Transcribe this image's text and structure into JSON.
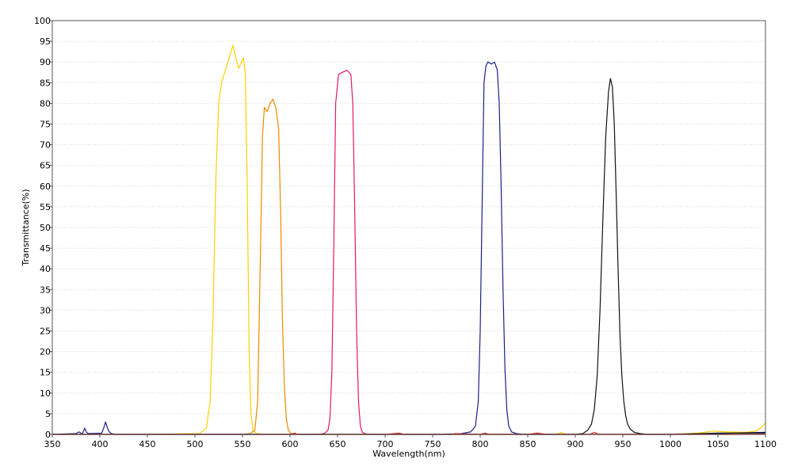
{
  "chart_data": {
    "type": "line",
    "title": "",
    "xlabel": "Wavelength(nm)",
    "ylabel": "Transmittance(%)",
    "xlim": [
      350,
      1100
    ],
    "ylim": [
      0,
      100
    ],
    "xticks": [
      350,
      400,
      450,
      500,
      550,
      600,
      650,
      700,
      750,
      800,
      850,
      900,
      950,
      1000,
      1050,
      1100
    ],
    "yticks": [
      0,
      5,
      10,
      15,
      20,
      25,
      30,
      35,
      40,
      45,
      50,
      55,
      60,
      65,
      70,
      75,
      80,
      85,
      90,
      95,
      100
    ],
    "grid": true,
    "legend": "none",
    "series": [
      {
        "color": "#ffd000",
        "x": [
          350,
          450,
          505,
          512,
          516,
          519,
          522,
          525,
          528,
          532,
          536,
          540,
          543,
          546,
          549,
          551,
          553,
          555,
          557,
          559,
          561,
          564,
          570,
          600,
          700,
          880,
          885,
          890,
          1000,
          1030,
          1045,
          1060,
          1080,
          1090,
          1095,
          1100
        ],
        "y": [
          0,
          0,
          0.2,
          1.5,
          8,
          28,
          62,
          80,
          85,
          88,
          91,
          94,
          91,
          88.5,
          90,
          91,
          87,
          60,
          20,
          5,
          1,
          0.3,
          0,
          0,
          0,
          0,
          0.5,
          0,
          0,
          0.3,
          0.8,
          0.6,
          0.5,
          0.8,
          1.5,
          2.8
        ]
      },
      {
        "color": "#ee8800",
        "x": [
          350,
          550,
          558,
          563,
          566,
          569,
          571,
          573,
          576,
          579,
          582,
          585,
          588,
          590,
          592,
          594,
          596,
          598,
          600,
          603,
          610,
          700,
          1100
        ],
        "y": [
          0,
          0,
          0.2,
          1,
          8,
          45,
          72,
          79,
          78,
          80,
          81,
          79,
          74,
          55,
          28,
          12,
          4,
          1.2,
          0.4,
          0.1,
          0,
          0,
          0
        ]
      },
      {
        "color": "#e0186c",
        "x": [
          350,
          630,
          636,
          640,
          642,
          644,
          646,
          648,
          651,
          655,
          660,
          664,
          666,
          668,
          670,
          672,
          674,
          676,
          680,
          685,
          700,
          1100
        ],
        "y": [
          0,
          0,
          0.2,
          1,
          4,
          15,
          45,
          80,
          87,
          87.5,
          88,
          87,
          80,
          55,
          25,
          8,
          2,
          0.5,
          0.1,
          0,
          0,
          0
        ]
      },
      {
        "color": "#1c2088",
        "x": [
          350,
          375,
          378,
          381,
          382,
          384,
          386,
          388,
          402,
          404,
          406,
          408,
          410,
          412,
          416,
          420,
          500,
          760,
          780,
          790,
          795,
          798,
          800,
          802,
          804,
          806,
          808,
          812,
          815,
          818,
          820,
          822,
          824,
          826,
          828,
          830,
          833,
          838,
          845,
          860,
          1000,
          1050,
          1100
        ],
        "y": [
          0,
          0.2,
          0.6,
          0.2,
          0.3,
          1.5,
          0.5,
          0.2,
          0.3,
          1.5,
          3,
          1.5,
          0.6,
          0.2,
          0,
          0,
          0,
          0,
          0.2,
          0.6,
          2,
          8,
          25,
          55,
          85,
          89,
          90,
          89.5,
          90,
          88,
          80,
          60,
          35,
          16,
          6,
          2,
          0.6,
          0.2,
          0,
          0,
          0,
          0.2,
          0.5
        ]
      },
      {
        "color": "#111111",
        "x": [
          350,
          900,
          908,
          913,
          917,
          920,
          923,
          926,
          929,
          932,
          935,
          937,
          939,
          941,
          943,
          945,
          947,
          949,
          951,
          953,
          955,
          958,
          962,
          968,
          975,
          1000,
          1050,
          1100
        ],
        "y": [
          0,
          0,
          0.2,
          1,
          2.5,
          6,
          14,
          30,
          52,
          72,
          83,
          86,
          84,
          75,
          58,
          40,
          24,
          14,
          8,
          4.5,
          2.5,
          1.2,
          0.5,
          0.2,
          0,
          0,
          0.3,
          0.3
        ]
      },
      {
        "color": "#d03030",
        "x": [
          350,
          600,
          605,
          608,
          700,
          715,
          720,
          770,
          775,
          800,
          805,
          810,
          850,
          860,
          870,
          915,
          920,
          925,
          1100
        ],
        "y": [
          0,
          0,
          0.3,
          0,
          0,
          0.3,
          0,
          0,
          0.2,
          0,
          0.3,
          0,
          0,
          0.3,
          0,
          0,
          0.5,
          0,
          0
        ]
      }
    ]
  }
}
